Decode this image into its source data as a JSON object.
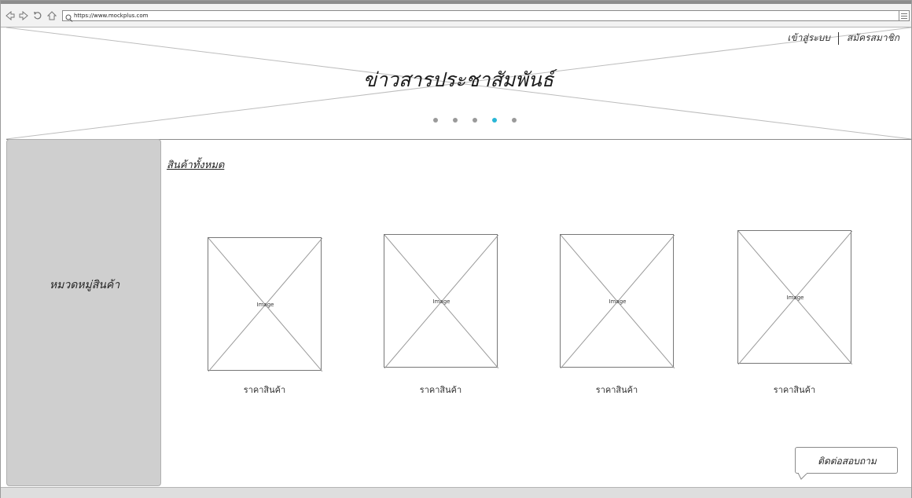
{
  "browser": {
    "url": "https://www.mockplus.com",
    "nav_icons": [
      "back-icon",
      "forward-icon",
      "reload-icon",
      "home-icon"
    ],
    "search_icon": "search-icon",
    "menu_icon": "hamburger-menu-icon"
  },
  "banner": {
    "title": "ข่าวสารประชาสัมพันธ์",
    "login": "เข้าสู่ระบบ",
    "register": "สมัครสมาชิก",
    "carousel_dots": 5,
    "active_dot": 4,
    "active_color": "#29b6d6"
  },
  "sidebar": {
    "label": "หมวดหมู่สินค้า"
  },
  "main": {
    "all_products": "สินค้าทั้งหมด",
    "products": [
      {
        "image_label": "Image",
        "price": "ราคาสินค้า"
      },
      {
        "image_label": "Image",
        "price": "ราคาสินค้า"
      },
      {
        "image_label": "Image",
        "price": "ราคาสินค้า"
      },
      {
        "image_label": "Image",
        "price": "ราคาสินค้า"
      }
    ]
  },
  "contact": {
    "label": "ติดต่อสอบถาม"
  }
}
